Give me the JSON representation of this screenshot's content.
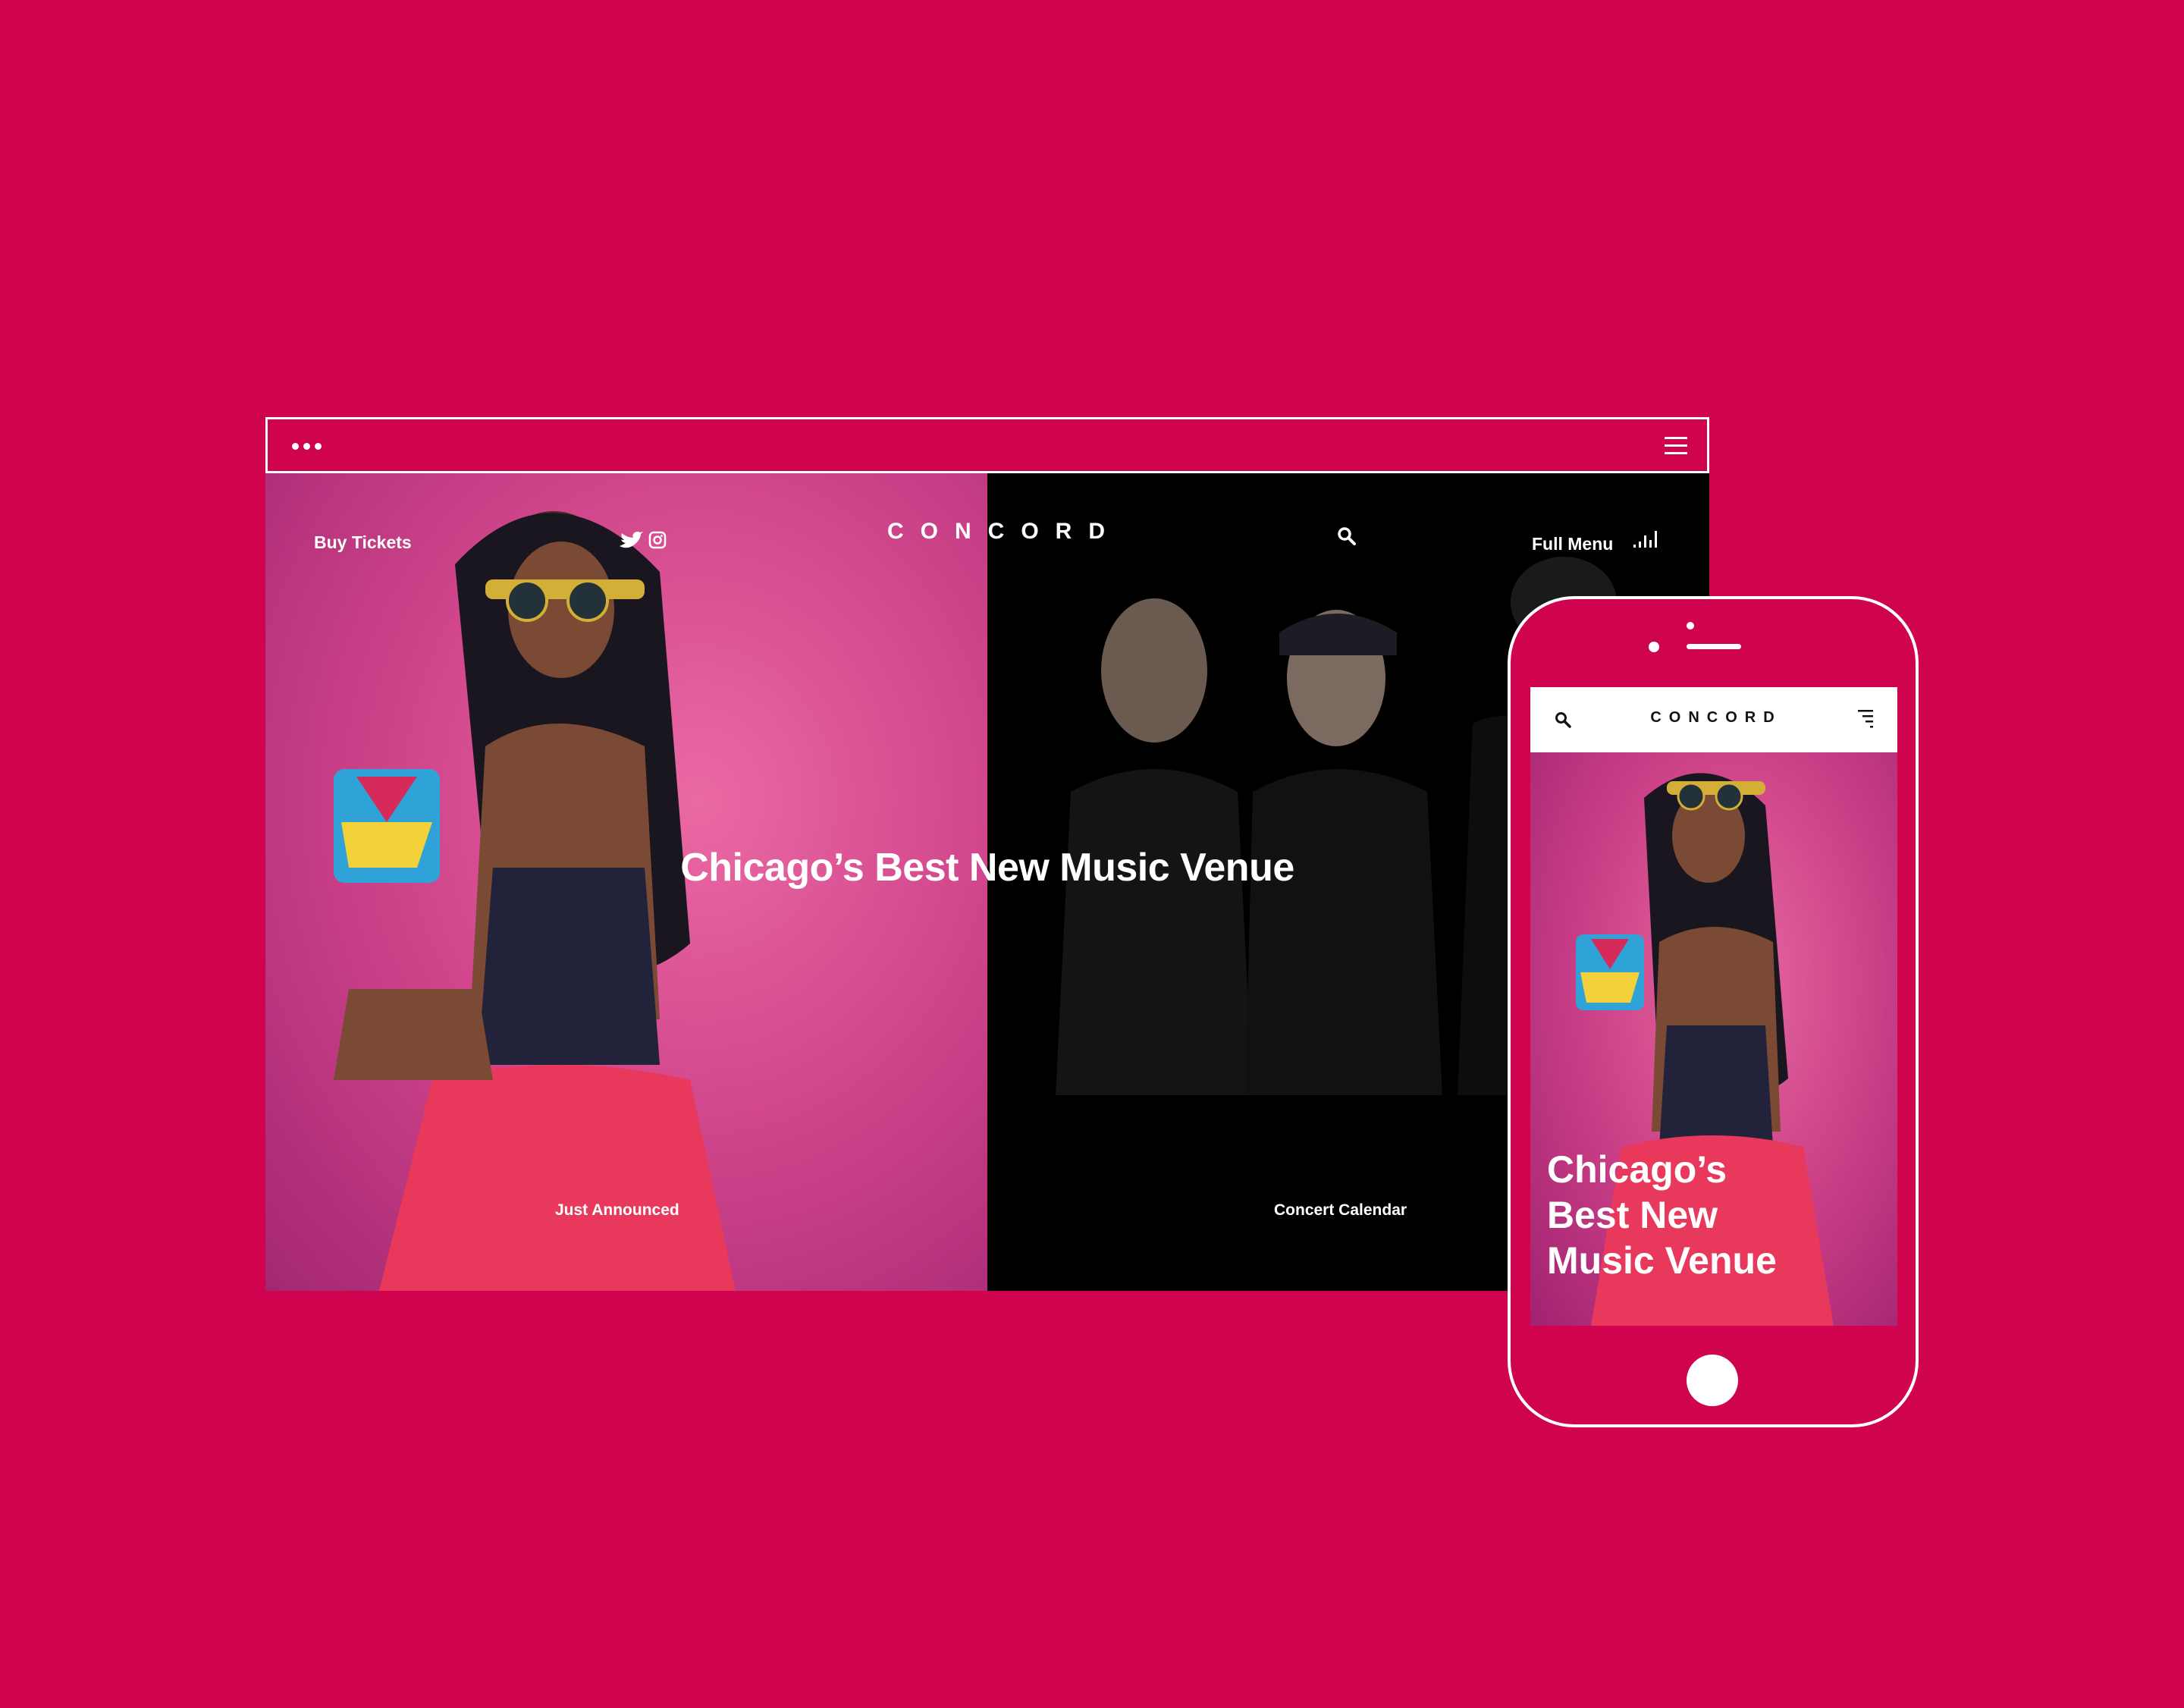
{
  "browser": {
    "dots_icon": "ellipsis-icon",
    "menu_icon": "hamburger-menu-icon"
  },
  "site": {
    "logo": "CONCORD",
    "nav": {
      "buy_tickets": "Buy Tickets",
      "full_menu": "Full Menu"
    },
    "icons": [
      "twitter-icon",
      "instagram-icon",
      "search-icon",
      "bars-icon"
    ],
    "hero_title": "Chicago’s Best New Music Venue",
    "bottom_links": {
      "left": "Just Announced",
      "right": "Concert Calendar"
    }
  },
  "phone": {
    "logo": "CONCORD",
    "hero_title_lines": [
      "Chicago’s",
      "Best New",
      "Music Venue"
    ]
  },
  "colors": {
    "background": "#cf034e",
    "left_panel": "#d2478d",
    "right_panel": "#000000",
    "text": "#ffffff"
  }
}
